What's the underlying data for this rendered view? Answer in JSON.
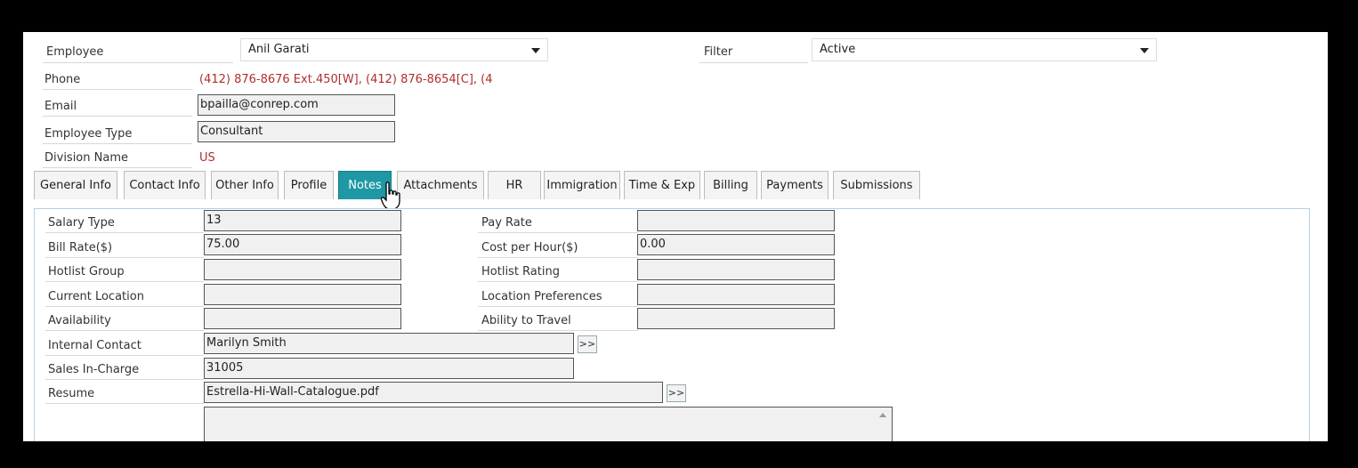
{
  "employee": {
    "label": "Employee",
    "value": "Anil  Garati"
  },
  "filter": {
    "label": "Filter",
    "value": "Active"
  },
  "phone": {
    "label": "Phone",
    "value": "(412) 876-8676 Ext.450[W], (412) 876-8654[C], (4"
  },
  "email": {
    "label": "Email",
    "value": "bpailla@conrep.com"
  },
  "employee_type": {
    "label": "Employee Type",
    "value": "Consultant"
  },
  "division": {
    "label": "Division Name",
    "value": "US"
  },
  "tabs": [
    {
      "label": "General Info"
    },
    {
      "label": "Contact Info"
    },
    {
      "label": "Other Info"
    },
    {
      "label": "Profile"
    },
    {
      "label": "Notes"
    },
    {
      "label": "Attachments"
    },
    {
      "label": "HR"
    },
    {
      "label": "Immigration"
    },
    {
      "label": "Time & Exp"
    },
    {
      "label": "Billing"
    },
    {
      "label": "Payments"
    },
    {
      "label": "Submissions"
    }
  ],
  "active_tab": "Notes",
  "fields": {
    "salary_type": {
      "label": "Salary Type",
      "value": "13"
    },
    "pay_rate": {
      "label": "Pay Rate",
      "value": ""
    },
    "bill_rate": {
      "label": "Bill Rate($)",
      "value": "75.00"
    },
    "cost_per_hour": {
      "label": "Cost per Hour($)",
      "value": "0.00"
    },
    "hotlist_group": {
      "label": "Hotlist Group",
      "value": ""
    },
    "hotlist_rating": {
      "label": "Hotlist Rating",
      "value": ""
    },
    "current_location": {
      "label": "Current Location",
      "value": ""
    },
    "location_preferences": {
      "label": "Location Preferences",
      "value": ""
    },
    "availability": {
      "label": "Availability",
      "value": ""
    },
    "ability_to_travel": {
      "label": "Ability to Travel",
      "value": ""
    },
    "internal_contact": {
      "label": "Internal Contact",
      "value": "Marilyn  Smith",
      "button": ">>"
    },
    "sales_in_charge": {
      "label": "Sales In-Charge",
      "value": "31005"
    },
    "resume": {
      "label": "Resume",
      "value": "Estrella-Hi-Wall-Catalogue.pdf",
      "button": ">>"
    }
  },
  "colors": {
    "active_tab": "#1f98a6",
    "red_text": "#b02e2e",
    "panel_border": "#b8cfe2"
  },
  "icons": {
    "select_arrow": "caret-down",
    "cursor": "hand-pointer"
  }
}
